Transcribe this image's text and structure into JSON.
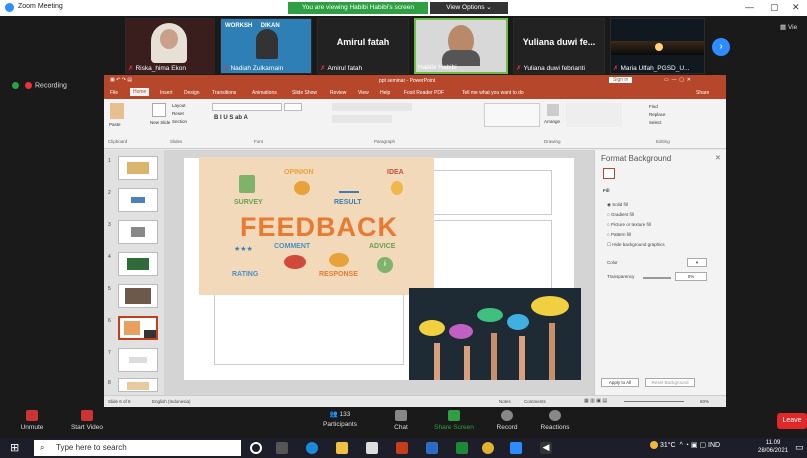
{
  "window": {
    "title": "Zoom Meeting",
    "minimize": "—",
    "maximize": "▢",
    "close": "✕"
  },
  "banner": {
    "viewing": "You are viewing Habibi Habibi's screen",
    "view_options": "View Options ⌄"
  },
  "participants": [
    {
      "name": "Riska_hima Ekon",
      "muted": true
    },
    {
      "name": "Nadiah Zulkarnain",
      "muted": true
    },
    {
      "name": "Amirul fatah",
      "big": "Amirul fatah",
      "muted": true
    },
    {
      "name": "Habibi Habibi",
      "muted": false
    },
    {
      "name": "Yuliana duwi febrianti",
      "big": "Yuliana duwi fe...",
      "muted": true
    },
    {
      "name": "Maria Ulfah_PGSD_U...",
      "muted": true
    }
  ],
  "view_label": "Vie",
  "recording": "Recording",
  "ppt": {
    "title": "ppt seminar - PowerPoint",
    "signin": "Sign in",
    "tabs": [
      "File",
      "Home",
      "Insert",
      "Design",
      "Transitions",
      "Animations",
      "Slide Show",
      "Review",
      "View",
      "Help",
      "Foxit Reader PDF",
      "Tell me what you want to do"
    ],
    "share": "Share",
    "ribbon_groups": [
      "Clipboard",
      "Slides",
      "Font",
      "Paragraph",
      "Drawing",
      "Editing"
    ],
    "ribbon_items": {
      "paste": "Paste",
      "new_slide": "New Slide",
      "layout": "Layout",
      "reset": "Reset",
      "section": "Section",
      "arrange": "Arrange",
      "find": "Find",
      "replace": "Replace",
      "select": "Select"
    },
    "slide_numbers": [
      "1",
      "2",
      "3",
      "4",
      "5",
      "6",
      "7",
      "8"
    ],
    "feedback": {
      "main": "FEEDBACK",
      "words": [
        "SURVEY",
        "OPINION",
        "RESULT",
        "IDEA",
        "COMMENT",
        "ADVICE",
        "RATING",
        "RESPONSE"
      ]
    },
    "format_pane": {
      "title": "Format Background",
      "section": "Fill",
      "options": [
        "Solid fill",
        "Gradient fill",
        "Picture or texture fill",
        "Pattern fill",
        "Hide background graphics"
      ],
      "color_label": "Color",
      "transparency_label": "Transparency",
      "transparency_value": "0%",
      "apply_all": "Apply to All",
      "reset": "Reset Background"
    },
    "status": {
      "slide": "Slide 6 of 8",
      "lang": "English (Indonesia)",
      "notes": "Notes",
      "comments": "Comments",
      "zoom": "60%"
    }
  },
  "toolbar": {
    "unmute": "Unmute",
    "start_video": "Start Video",
    "participants": "Participants",
    "participants_count": "133",
    "chat": "Chat",
    "share_screen": "Share Screen",
    "record": "Record",
    "reactions": "Reactions",
    "leave": "Leave"
  },
  "taskbar": {
    "search": "Type here to search",
    "temp": "31°C",
    "lang": "IND",
    "time": "11.09",
    "date": "28/06/2021"
  }
}
